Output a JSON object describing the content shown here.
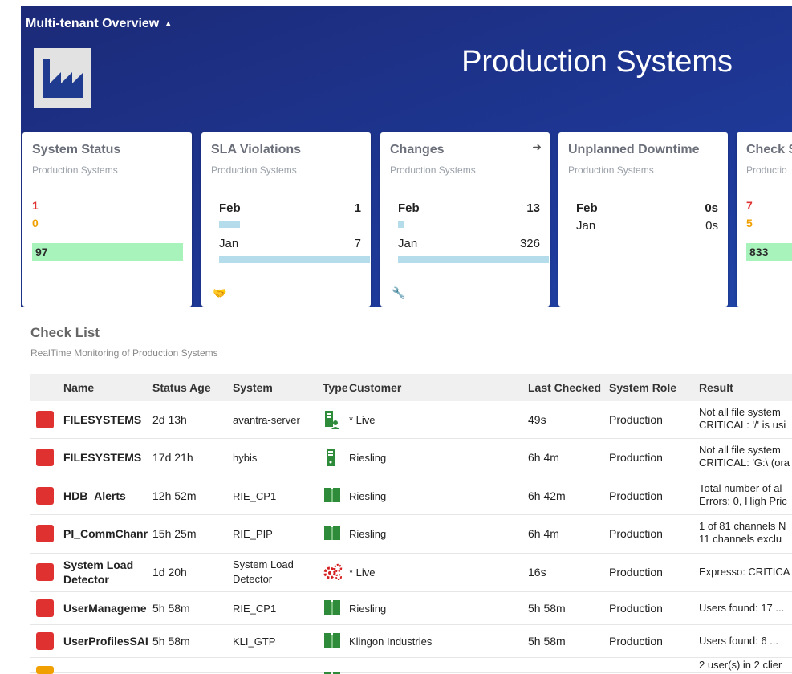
{
  "header": {
    "dashboard_title": "Multi-tenant Overview",
    "page_title": "Production Systems"
  },
  "cards": {
    "system_status": {
      "title": "System Status",
      "subtitle": "Production Systems",
      "critical": "1",
      "warning": "0",
      "ok": "97"
    },
    "sla": {
      "title": "SLA Violations",
      "subtitle": "Production Systems",
      "rows": [
        {
          "label": "Feb",
          "value": "1",
          "fill": 0.14
        },
        {
          "label": "Jan",
          "value": "7",
          "fill": 1.0
        }
      ]
    },
    "changes": {
      "title": "Changes",
      "subtitle": "Production Systems",
      "rows": [
        {
          "label": "Feb",
          "value": "13",
          "fill": 0.04
        },
        {
          "label": "Jan",
          "value": "326",
          "fill": 1.0
        }
      ]
    },
    "downtime": {
      "title": "Unplanned Downtime",
      "subtitle": "Production Systems",
      "rows": [
        {
          "label": "Feb",
          "value": "0s"
        },
        {
          "label": "Jan",
          "value": "0s"
        }
      ]
    },
    "check": {
      "title": "Check S",
      "subtitle": "Productio",
      "critical": "7",
      "warning": "5",
      "ok": "833"
    }
  },
  "checklist": {
    "title": "Check List",
    "subtitle": "RealTime Monitoring of Production Systems",
    "columns": [
      "Name",
      "Status Age",
      "System",
      "Type",
      "Customer",
      "Last Checked",
      "System Role",
      "Result"
    ],
    "rows": [
      {
        "name": "FILESYSTEMS",
        "age": "2d 13h",
        "system": "avantra-server",
        "type_icon": "server-person-icon",
        "customer": "* Live",
        "last_checked": "49s",
        "role": "Production",
        "result": [
          "Not all file system",
          "CRITICAL: '/' is usi"
        ]
      },
      {
        "name": "FILESYSTEMS",
        "age": "17d 21h",
        "system": "hybis",
        "type_icon": "server-icon",
        "customer": "Riesling",
        "last_checked": "6h 4m",
        "role": "Production",
        "result": [
          "Not all file system",
          "CRITICAL: 'G:\\ (ora"
        ]
      },
      {
        "name": "HDB_Alerts",
        "age": "12h 52m",
        "system": "RIE_CP1",
        "type_icon": "book-icon",
        "customer": "Riesling",
        "last_checked": "6h 42m",
        "role": "Production",
        "result": [
          "Total number of al",
          "Errors: 0, High Pric"
        ]
      },
      {
        "name": "PI_CommChanr",
        "age": "15h 25m",
        "system": "RIE_PIP",
        "type_icon": "book-icon",
        "customer": "Riesling",
        "last_checked": "6h 4m",
        "role": "Production",
        "result": [
          "1 of 81 channels N",
          "11 channels exclu"
        ]
      },
      {
        "name": "System Load Detector",
        "age": "1d 20h",
        "system": "System Load Detector",
        "type_icon": "gears-icon",
        "customer": "* Live",
        "last_checked": "16s",
        "role": "Production",
        "result": [
          "Expresso: CRITICA"
        ]
      },
      {
        "name": "UserManageme",
        "age": "5h 58m",
        "system": "RIE_CP1",
        "type_icon": "book-icon",
        "customer": "Riesling",
        "last_checked": "5h 58m",
        "role": "Production",
        "result": [
          "Users found: 17 ..."
        ]
      },
      {
        "name": "UserProfilesSAI",
        "age": "5h 58m",
        "system": "KLI_GTP",
        "type_icon": "book-icon",
        "customer": "Klingon Industries",
        "last_checked": "5h 58m",
        "role": "Production",
        "result": [
          "Users found: 6 ..."
        ]
      }
    ],
    "partial_row_result": "2 user(s) in 2 clier"
  },
  "colors": {
    "critical": "#e03131",
    "warning": "#f0a000",
    "ok_fill": "#a8f2bc",
    "bar": "#b5dcea",
    "type_green": "#2e8b3a",
    "type_red": "#d42020"
  }
}
